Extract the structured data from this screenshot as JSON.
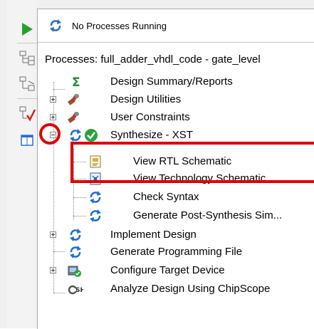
{
  "status": {
    "text": "No Processes Running",
    "icon": "refresh-arrows-icon"
  },
  "processes": {
    "title": "Processes: full_adder_vhdl_code - gate_level",
    "items": [
      {
        "label": "Design Summary/Reports",
        "icon": "sigma-icon"
      },
      {
        "label": "Design Utilities",
        "icon": "tools-icon"
      },
      {
        "label": "User Constraints",
        "icon": "tools-icon"
      },
      {
        "label": "Synthesize - XST",
        "icon": "refresh-check-icon"
      },
      {
        "label": "View RTL Schematic",
        "icon": "schematic-icon"
      },
      {
        "label": "View Technology Schematic",
        "icon": "schematic-icon"
      },
      {
        "label": "Check Syntax",
        "icon": "refresh-arrows-icon"
      },
      {
        "label": "Generate Post-Synthesis Sim...",
        "icon": "refresh-arrows-icon"
      },
      {
        "label": "Implement Design",
        "icon": "refresh-arrows-icon"
      },
      {
        "label": "Generate Programming File",
        "icon": "refresh-arrows-icon"
      },
      {
        "label": "Configure Target Device",
        "icon": "device-icon"
      },
      {
        "label": "Analyze Design Using ChipScope",
        "icon": "chipscope-icon"
      }
    ]
  },
  "colors": {
    "highlight": "#e00000",
    "accent_blue": "#1f6fd0",
    "accent_green": "#2aa23a"
  }
}
